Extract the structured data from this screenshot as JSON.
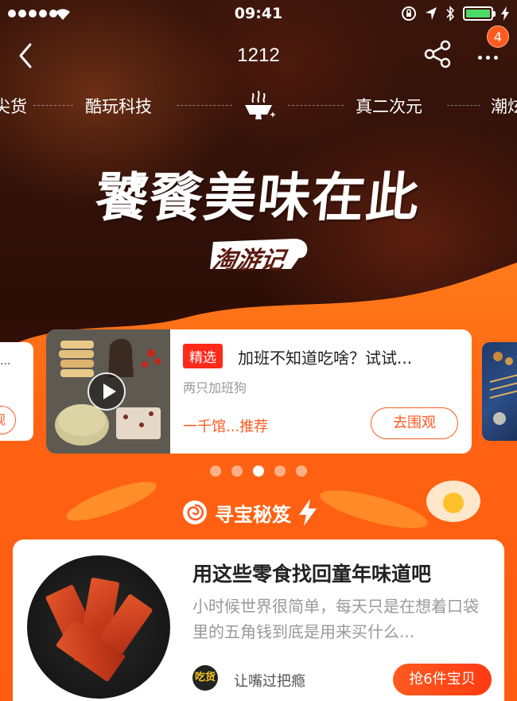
{
  "status_bar": {
    "time": "09:41"
  },
  "nav": {
    "title": "1212",
    "badge_count": "4"
  },
  "channels": [
    {
      "label": "尖货"
    },
    {
      "label": "酷玩科技"
    },
    {
      "label": "真二次元"
    },
    {
      "label": "潮炫"
    }
  ],
  "hero": {
    "headline": "饕餮美味在此",
    "logo_text": "淘游记"
  },
  "carousel": {
    "page_count": 5,
    "active_index": 2,
    "left_card": {
      "text": "...",
      "button_label": "观"
    },
    "main_card": {
      "tag": "精选",
      "title": "加班不知道吃啥？试试...",
      "author": "两只加班狗",
      "recommend_text": "一千馆...推荐",
      "button_label": "去围观"
    }
  },
  "section": {
    "title": "寻宝秘笈"
  },
  "feature_card": {
    "title": "用这些零食找回童年味道吧",
    "description": "小时候世界很简单，每天只是在想着口袋里的五角钱到底是用来买什么...",
    "avatar_text": "吃货",
    "user_name": "让嘴过把瘾",
    "button_label": "抢6件宝贝"
  },
  "colors": {
    "accent": "#ff5a1f",
    "tag_red": "#ff2a1a",
    "battery_green": "#4cd964"
  },
  "icons": [
    "back-icon",
    "share-icon",
    "more-icon",
    "wifi-icon",
    "food-icon",
    "play-icon",
    "lollipop-icon",
    "bolt-icon"
  ]
}
